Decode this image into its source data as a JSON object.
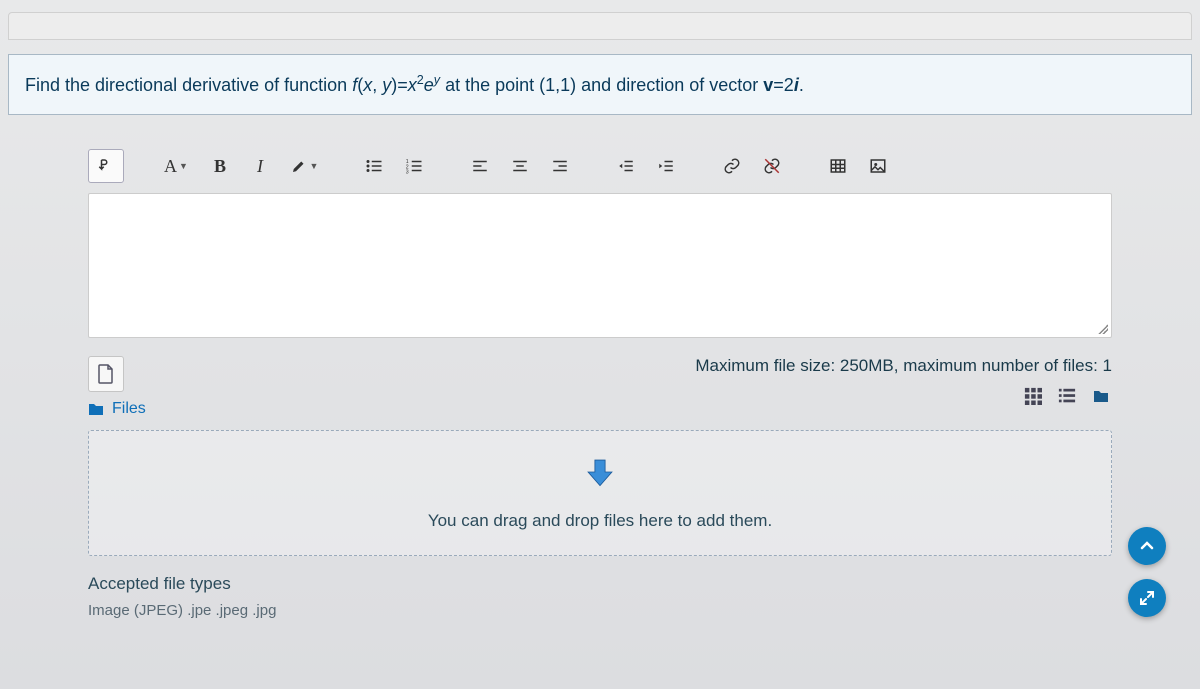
{
  "question": {
    "pre": "Find the directional derivative of function ",
    "fn": "f",
    "args_open": "(",
    "x": "x",
    "comma": ", ",
    "y": "y",
    "args_close": ")",
    "eq": "=",
    "x2": "x",
    "sup2": "2",
    "e": "e",
    "supy": "y",
    "mid": " at the point ",
    "pt": "(1,1)",
    "mid2": " and direction of vector ",
    "v": "v",
    "eq2": "=2",
    "i": "i",
    "end": "."
  },
  "toolbar": {
    "font_letter": "A",
    "bold": "B",
    "italic": "I"
  },
  "upload": {
    "max_label": "Maximum file size: 250MB, maximum number of files: 1",
    "files_label": "Files",
    "drop_text": "You can drag and drop files here to add them.",
    "accepted_title": "Accepted file types",
    "accepted_types": "Image (JPEG) .jpe .jpeg .jpg"
  }
}
